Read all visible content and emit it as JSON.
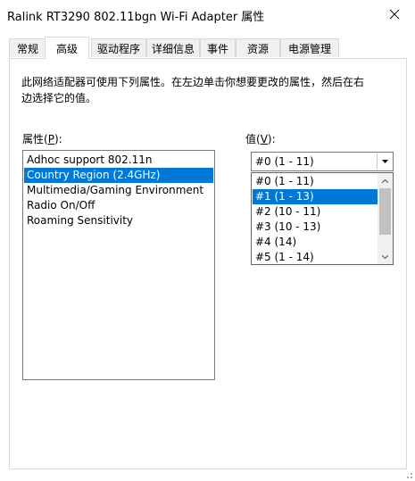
{
  "window": {
    "title": "Ralink RT3290 802.11bgn Wi-Fi Adapter 属性"
  },
  "tabs": [
    {
      "label": "常规"
    },
    {
      "label": "高级"
    },
    {
      "label": "驱动程序"
    },
    {
      "label": "详细信息"
    },
    {
      "label": "事件"
    },
    {
      "label": "资源"
    },
    {
      "label": "电源管理"
    }
  ],
  "active_tab": "高级",
  "description": "此网络适配器可使用下列属性。在左边单击你想要更改的属性，然后在右边选择它的值。",
  "property_label": {
    "text": "属性(",
    "mnemonic": "P",
    "suffix": "):"
  },
  "value_label": {
    "text": "值(",
    "mnemonic": "V",
    "suffix": "):"
  },
  "properties": [
    {
      "label": "Adhoc support 802.11n"
    },
    {
      "label": "Country Region (2.4GHz)"
    },
    {
      "label": "Multimedia/Gaming Environment"
    },
    {
      "label": "Radio On/Off"
    },
    {
      "label": "Roaming Sensitivity"
    }
  ],
  "selected_property": "Country Region (2.4GHz)",
  "value_combo": {
    "current": "#0 (1 - 11)"
  },
  "value_options": [
    {
      "label": "#0 (1 - 11)"
    },
    {
      "label": "#1 (1 - 13)"
    },
    {
      "label": "#2 (10 - 11)"
    },
    {
      "label": "#3 (10 - 13)"
    },
    {
      "label": "#4 (14)"
    },
    {
      "label": "#5 (1 - 14)"
    }
  ],
  "highlighted_option": "#1 (1 - 13)",
  "colors": {
    "selection": "#0078d7",
    "border": "#7a7a7a",
    "tab_border": "#d9d9d9"
  }
}
